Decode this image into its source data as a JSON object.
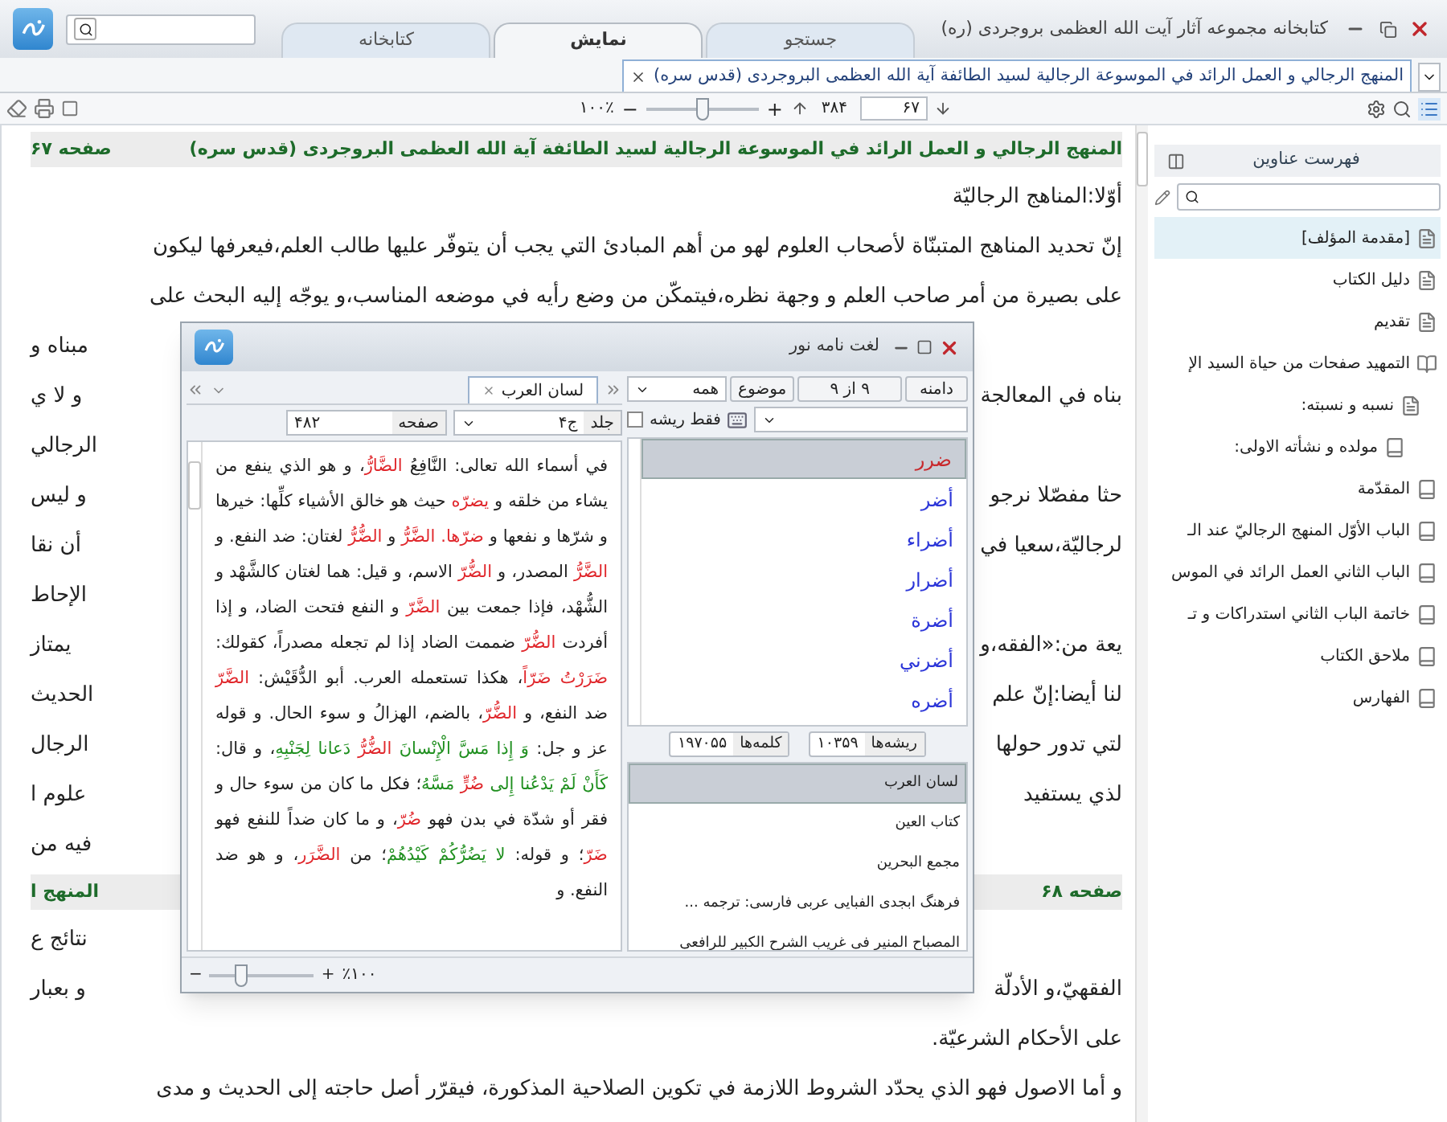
{
  "window": {
    "title": "کتابخانه مجموعه آثار آیت الله العظمی بروجردی (ره)",
    "tabs": [
      {
        "label": "جستجو",
        "selected": false
      },
      {
        "label": "نمایش",
        "selected": true
      },
      {
        "label": "کتابخانه",
        "selected": false
      }
    ]
  },
  "document_tab": {
    "title": "المنهج الرجالي و العمل الرائد في الموسوعة الرجالية لسيد الطائفة آية الله العظمى البروجردى (قدس سره)"
  },
  "toolbar": {
    "zoom": "۱۰۰٪",
    "zoom_in": "+",
    "zoom_out": "−",
    "level": 0.5,
    "total_pages": "۳۸۴",
    "page": "۶۷"
  },
  "main": {
    "lines": [
      {
        "kind": "header",
        "right": "المنهج الرجالي و العمل الرائد في الموسوعة الرجالية لسيد الطائفة آية الله العظمى البروجردى (قدس سره)",
        "left": "صفحه ۶۷"
      },
      {
        "kind": "text",
        "right": "أوّلا:المناهج الرجاليّة"
      },
      {
        "kind": "text",
        "right": "إنّ تحديد المناهج المتبنّاة لأصحاب العلوم لهو من أهم المبادئ التي يجب أن يتوفّر عليها طالب العلم،فيعرفها ليكون"
      },
      {
        "kind": "text",
        "right": "على بصيرة من أمر صاحب العلم و وجهة نظره،فيتمكّن من وضع رأيه في موضعه المناسب،و يوجّه إليه البحث على"
      },
      {
        "kind": "text",
        "left": "مبناه و"
      },
      {
        "kind": "text",
        "left": "و لا ي",
        "right": "بناه في المعالجة"
      },
      {
        "kind": "text",
        "left": "الرجالي"
      },
      {
        "kind": "text",
        "left": "و ليس",
        "right": "حثا مفصّلا نرجو"
      },
      {
        "kind": "text",
        "left": "أن نقا",
        "right": "لرجاليّة،سعيا في"
      },
      {
        "kind": "text",
        "left": "الإحاط"
      },
      {
        "kind": "text",
        "left": "يمتاز",
        "right": "يعة من:«الفقه،و"
      },
      {
        "kind": "text",
        "left": "الحديث",
        "right": "لنا أيضا:إنّ علم"
      },
      {
        "kind": "text",
        "left": "الرجال",
        "right": "لتي تدور حولها"
      },
      {
        "kind": "text",
        "left": "علوم ا",
        "right": "لذي يستفيد"
      },
      {
        "kind": "text",
        "left": "فيه من"
      },
      {
        "kind": "header",
        "left": "المنهج ا",
        "right": "صفحه ۶۸"
      },
      {
        "kind": "text",
        "left": "نتائج ع"
      },
      {
        "kind": "text",
        "left": "و بعبار",
        "right": "الفقهيّ،و الأدلّة"
      },
      {
        "kind": "text",
        "right": "على الأحكام الشرعيّة."
      },
      {
        "kind": "text",
        "right": "و أما الاصول فهو الذي يحدّد الشروط اللازمة في تكوين الصلاحية المذكورة، فيقرّر أصل حاجته إلى الحديث و مدى"
      }
    ]
  },
  "sidebar": {
    "title": "فهرست عناوين",
    "items": [
      {
        "label": "[مقدمة المؤلف]",
        "kind": "page",
        "selected": true
      },
      {
        "label": "دليل الكتاب",
        "kind": "page",
        "selected": false
      },
      {
        "label": "تقديم",
        "kind": "page",
        "selected": false
      },
      {
        "label": "التمهيد صفحات من حياة السيد الإ",
        "kind": "open",
        "selected": false,
        "children": [
          {
            "label": "نسبه و نسبته:",
            "kind": "page",
            "selected": false,
            "children": [
              {
                "label": "مولده و نشأته الاولى:",
                "kind": "book",
                "selected": false
              }
            ]
          }
        ]
      },
      {
        "label": "المقدّمة",
        "kind": "book",
        "selected": false
      },
      {
        "label": "الباب الأوّل المنهج الرجاليّ عند الـ",
        "kind": "book",
        "selected": false
      },
      {
        "label": "الباب الثاني العمل الرائد في الموس",
        "kind": "book",
        "selected": false
      },
      {
        "label": "خاتمة الباب الثاني استدراكات و تـ",
        "kind": "book",
        "selected": false
      },
      {
        "label": "ملاحق الكتاب",
        "kind": "book",
        "selected": false
      },
      {
        "label": "الفهارس",
        "kind": "book",
        "selected": false
      }
    ]
  },
  "dictionary": {
    "title": "لغت نامه نور",
    "scope_button": "دامنه",
    "scope_count": "۹ از ۹",
    "subject_label": "موضوع",
    "subject_value": "همه",
    "root_only": {
      "label": "فقط ریشه",
      "checked": false
    },
    "words": [
      {
        "label": "ضرر",
        "selected": true
      },
      {
        "label": "أضر",
        "selected": false
      },
      {
        "label": "أضراء",
        "selected": false
      },
      {
        "label": "أضرار",
        "selected": false
      },
      {
        "label": "أضرة",
        "selected": false
      },
      {
        "label": "أضرني",
        "selected": false
      },
      {
        "label": "أضره",
        "selected": false
      }
    ],
    "roots_label": "ریشه‌ها",
    "roots_count": "۱۰۳۵۹",
    "words_label": "کلمه‌ها",
    "words_count": "۱۹۷۰۵۵",
    "books": [
      {
        "label": "لسان العرب",
        "selected": true
      },
      {
        "label": "كتاب العين",
        "selected": false
      },
      {
        "label": "مجمع البحرين",
        "selected": false
      },
      {
        "label": "فرهنگ ابجدى الفبايى عربى  فارسى: ترجمه ...",
        "selected": false
      },
      {
        "label": "المصباح المنير فى غريب الشرح الكبير للرافعى",
        "selected": false
      }
    ],
    "open_tab": "لسان العرب",
    "volume_label": "جلد",
    "volume": "ج۴",
    "page_label": "صفحه",
    "page": "۴۸۲",
    "zoom": "٪۱۰۰",
    "zoom_in": "+",
    "zoom_out": "−",
    "level": 0.3,
    "segments": [
      {
        "kind": "plain",
        "text": "في أسماء الله تعالى: النَّافِعُ "
      },
      {
        "kind": "entry",
        "text": "الضَّارُّ"
      },
      {
        "kind": "plain",
        "text": "، و هو الذي ينفع من يشاء من خلقه و "
      },
      {
        "kind": "entry",
        "text": "يضرّه"
      },
      {
        "kind": "plain",
        "text": " حيث هو خالق الأشياء كلِّها: خيرها و شرّها و نفعها و "
      },
      {
        "kind": "entry",
        "text": "ضرّها. "
      },
      {
        "kind": "entry",
        "text": "الضَّرُّ"
      },
      {
        "kind": "plain",
        "text": " و "
      },
      {
        "kind": "entry",
        "text": "الضُّرُّ"
      },
      {
        "kind": "plain",
        "text": " لغتان: ضد النفع. و "
      },
      {
        "kind": "entry",
        "text": "الضَّرُّ"
      },
      {
        "kind": "plain",
        "text": " المصدر، و "
      },
      {
        "kind": "entry",
        "text": "الضُّرّ"
      },
      {
        "kind": "plain",
        "text": " الاسم، و قيل: هما لغتان كالشَّهْد و الشُّهْد، فإذا جمعت بين "
      },
      {
        "kind": "entry",
        "text": "الضَّرّ"
      },
      {
        "kind": "plain",
        "text": " و النفع فتحت الضاد، و إذا أفردت "
      },
      {
        "kind": "entry",
        "text": "الضُّرّ"
      },
      {
        "kind": "plain",
        "text": " ضممت الضاد إذا لم تجعله مصدراً، كقولك: "
      },
      {
        "kind": "entry",
        "text": "ضَرَرْتُ ضَرّاً"
      },
      {
        "kind": "plain",
        "text": "، هكذا تستعمله العرب. أبو الدُّقَيْش: "
      },
      {
        "kind": "entry",
        "text": "الضَّرّ"
      },
      {
        "kind": "plain",
        "text": " ضد النفع، و "
      },
      {
        "kind": "entry",
        "text": "الضُّرّ"
      },
      {
        "kind": "plain",
        "text": "، بالضم، الهزالُ و سوء الحال. و قوله عز و جل: "
      },
      {
        "kind": "quran",
        "text": "وَ إِذا مَسَّ الْإِنْسانَ "
      },
      {
        "kind": "entry",
        "text": "الضُّرُّ "
      },
      {
        "kind": "quran",
        "text": "دَعانا لِجَنْبِهِ"
      },
      {
        "kind": "plain",
        "text": "، و قال: "
      },
      {
        "kind": "quran",
        "text": "كَأَنْ لَمْ يَدْعُنا إِلى "
      },
      {
        "kind": "entry",
        "text": "ضُرٍّ "
      },
      {
        "kind": "quran",
        "text": "مَسَّهُ"
      },
      {
        "kind": "plain",
        "text": "؛ فكل ما كان من سوء حال و فقر أو شدّة في بدن فهو "
      },
      {
        "kind": "entry",
        "text": "ضُرّ"
      },
      {
        "kind": "plain",
        "text": "، و ما كان ضداً للنفع فهو "
      },
      {
        "kind": "entry",
        "text": "ضَرّ"
      },
      {
        "kind": "plain",
        "text": "؛ و قوله: "
      },
      {
        "kind": "quran",
        "text": "لا يَضُرُّكُمْ كَيْدُهُمْ"
      },
      {
        "kind": "plain",
        "text": "؛ من "
      },
      {
        "kind": "entry",
        "text": "الضَّرَر"
      },
      {
        "kind": "plain",
        "text": "، و هو ضد النفع. و"
      }
    ]
  }
}
